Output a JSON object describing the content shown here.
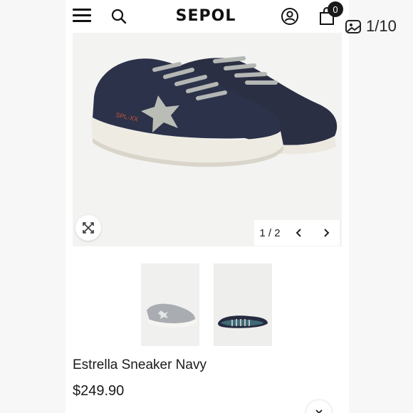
{
  "header": {
    "logo": "SEPOL",
    "cart_count": "0"
  },
  "gallery_counter": {
    "text": "1/10",
    "icon": "gallery-icon"
  },
  "product": {
    "name": "Estrella Sneaker Navy",
    "price": "$249.90",
    "shoe_print": "SPL-XX"
  },
  "image_pager": {
    "text": "1 / 2",
    "prev_icon": "chevron-left-icon",
    "next_icon": "chevron-right-icon"
  },
  "icons": {
    "menu": "hamburger-menu-icon",
    "search": "search-icon",
    "account": "account-icon",
    "bag": "shopping-bag-icon",
    "zoom": "expand-icon"
  },
  "colors": {
    "navy": "#2b3147",
    "sole": "#efece4",
    "accent_red": "#c8553d",
    "star_gray": "#b7bcb5"
  }
}
